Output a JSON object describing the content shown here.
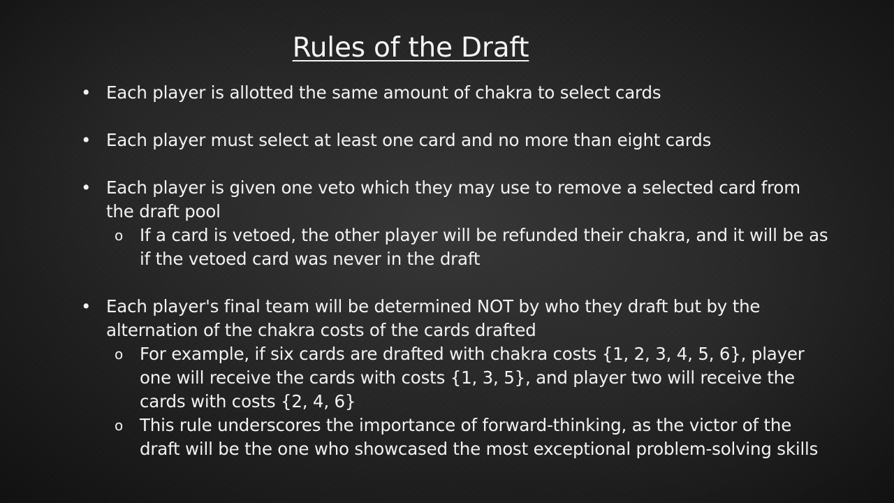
{
  "slide": {
    "title": "Rules of the Draft",
    "bullet_symbol": "•",
    "sub_bullet_symbol": "o",
    "items": [
      {
        "text": "Each player is allotted the same amount of chakra to select cards",
        "subitems": []
      },
      {
        "text": "Each player must select at least one card and no more than eight cards",
        "subitems": []
      },
      {
        "text": "Each player is given one veto which they may use to remove a selected card from the draft pool",
        "subitems": [
          "If a card is vetoed, the other player will be refunded their chakra, and it will be as if the vetoed card was never in the draft"
        ]
      },
      {
        "text": "Each player's final team will be determined NOT by who they draft but by the alternation of the chakra costs of the cards drafted",
        "subitems": [
          "For example, if six cards are drafted with chakra costs {1, 2, 3, 4, 5, 6}, player one will receive the cards with costs {1, 3, 5}, and player two will receive the cards with costs {2, 4, 6}",
          "This rule underscores the importance of forward-thinking, as the victor of the draft will be the one who showcased the most exceptional problem-solving skills"
        ]
      }
    ]
  }
}
